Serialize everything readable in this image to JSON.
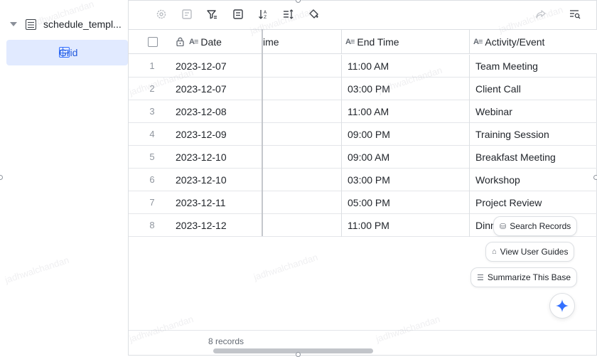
{
  "sidebar": {
    "root_label": "schedule_templ...",
    "view_label": "Grid"
  },
  "toolbar": {
    "icons": [
      "gear-icon",
      "form-icon",
      "filter-icon",
      "group-icon",
      "sort-icon",
      "row-height-icon",
      "fill-color-icon",
      "share-icon",
      "search-panel-icon"
    ]
  },
  "table": {
    "headers": {
      "date": "Date",
      "start_time": "ime",
      "end_time": "End Time",
      "activity": "Activity/Event"
    },
    "rows": [
      {
        "num": "1",
        "date": "2023-12-07",
        "end": "11:00 AM",
        "activity": "Team Meeting"
      },
      {
        "num": "2",
        "date": "2023-12-07",
        "end": "03:00 PM",
        "activity": "Client Call"
      },
      {
        "num": "3",
        "date": "2023-12-08",
        "end": "11:00 AM",
        "activity": "Webinar"
      },
      {
        "num": "4",
        "date": "2023-12-09",
        "end": "09:00 PM",
        "activity": "Training Session"
      },
      {
        "num": "5",
        "date": "2023-12-10",
        "end": "09:00 AM",
        "activity": "Breakfast Meeting"
      },
      {
        "num": "6",
        "date": "2023-12-10",
        "end": "03:00 PM",
        "activity": "Workshop"
      },
      {
        "num": "7",
        "date": "2023-12-11",
        "end": "05:00 PM",
        "activity": "Project Review"
      },
      {
        "num": "8",
        "date": "2023-12-12",
        "end": "11:00 PM",
        "activity": "Dinn"
      }
    ]
  },
  "footer": {
    "records": "8 records"
  },
  "assistant": {
    "search_records": "Search Records",
    "view_user_guides": "View User Guides",
    "summarize_base": "Summarize This Base"
  },
  "watermark": "jadhwalchandan",
  "colors": {
    "accent": "#3370ff",
    "selected_bg": "#e1eaff",
    "border": "#dcdfe3"
  }
}
